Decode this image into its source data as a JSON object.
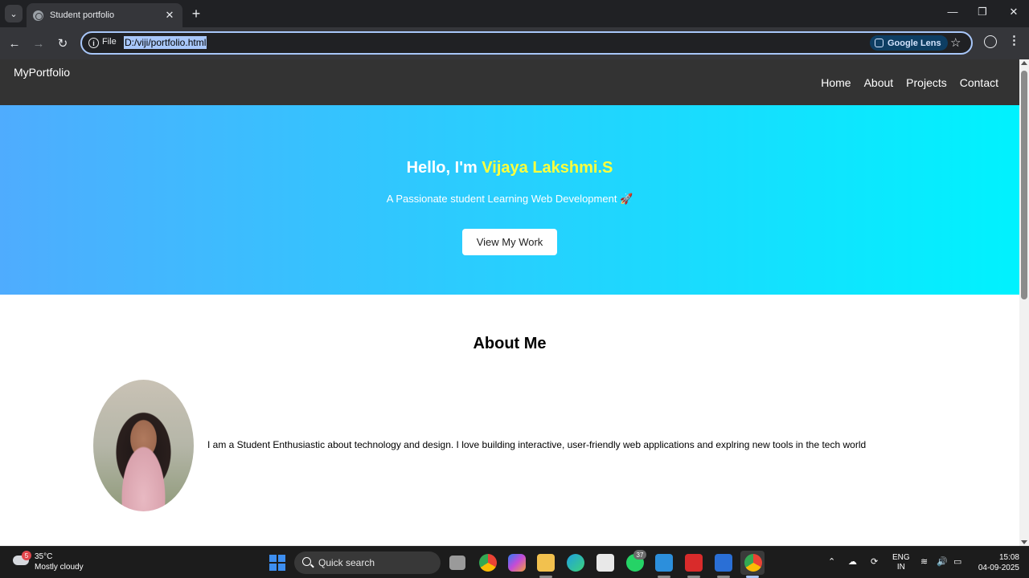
{
  "browser": {
    "tab_title": "Student portfolio",
    "scheme_label": "File",
    "url": "D:/viji/portfolio.html",
    "lens_label": "Google Lens"
  },
  "site": {
    "logo": "MyPortfolio",
    "nav": [
      "Home",
      "About",
      "Projects",
      "Contact"
    ],
    "hero": {
      "greeting": "Hello, I'm",
      "name": "Vijaya Lakshmi.S",
      "subtitle": "A Passionate student Learning Web Development 🚀",
      "button": "View My Work",
      "gradient_start": "#4facfe",
      "gradient_end": "#00f2fe",
      "name_color": "#ffff3b"
    },
    "about": {
      "title": "About Me",
      "text": "I am a Student Enthusiastic about technology and design. I love building interactive, user-friendly web applications and explring new tools in the tech world"
    }
  },
  "taskbar": {
    "weather_badge": "5",
    "temperature": "35°C",
    "weather": "Mostly cloudy",
    "search_label": "Quick search",
    "whatsapp_badge": "37",
    "lang_top": "ENG",
    "lang_bottom": "IN",
    "time": "15:08",
    "date": "04-09-2025"
  }
}
